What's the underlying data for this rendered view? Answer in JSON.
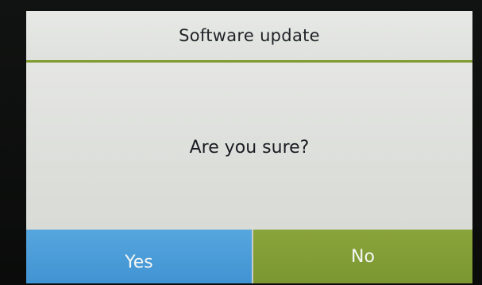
{
  "dialog": {
    "title": "Software update",
    "message": "Are you sure?",
    "buttons": {
      "yes_label": "Yes",
      "no_label": "No"
    }
  },
  "colors": {
    "title_underline": "#7e9a2e",
    "yes_button": "#4a9dd8",
    "no_button": "#809c35",
    "screen_background": "#dcdedb"
  }
}
